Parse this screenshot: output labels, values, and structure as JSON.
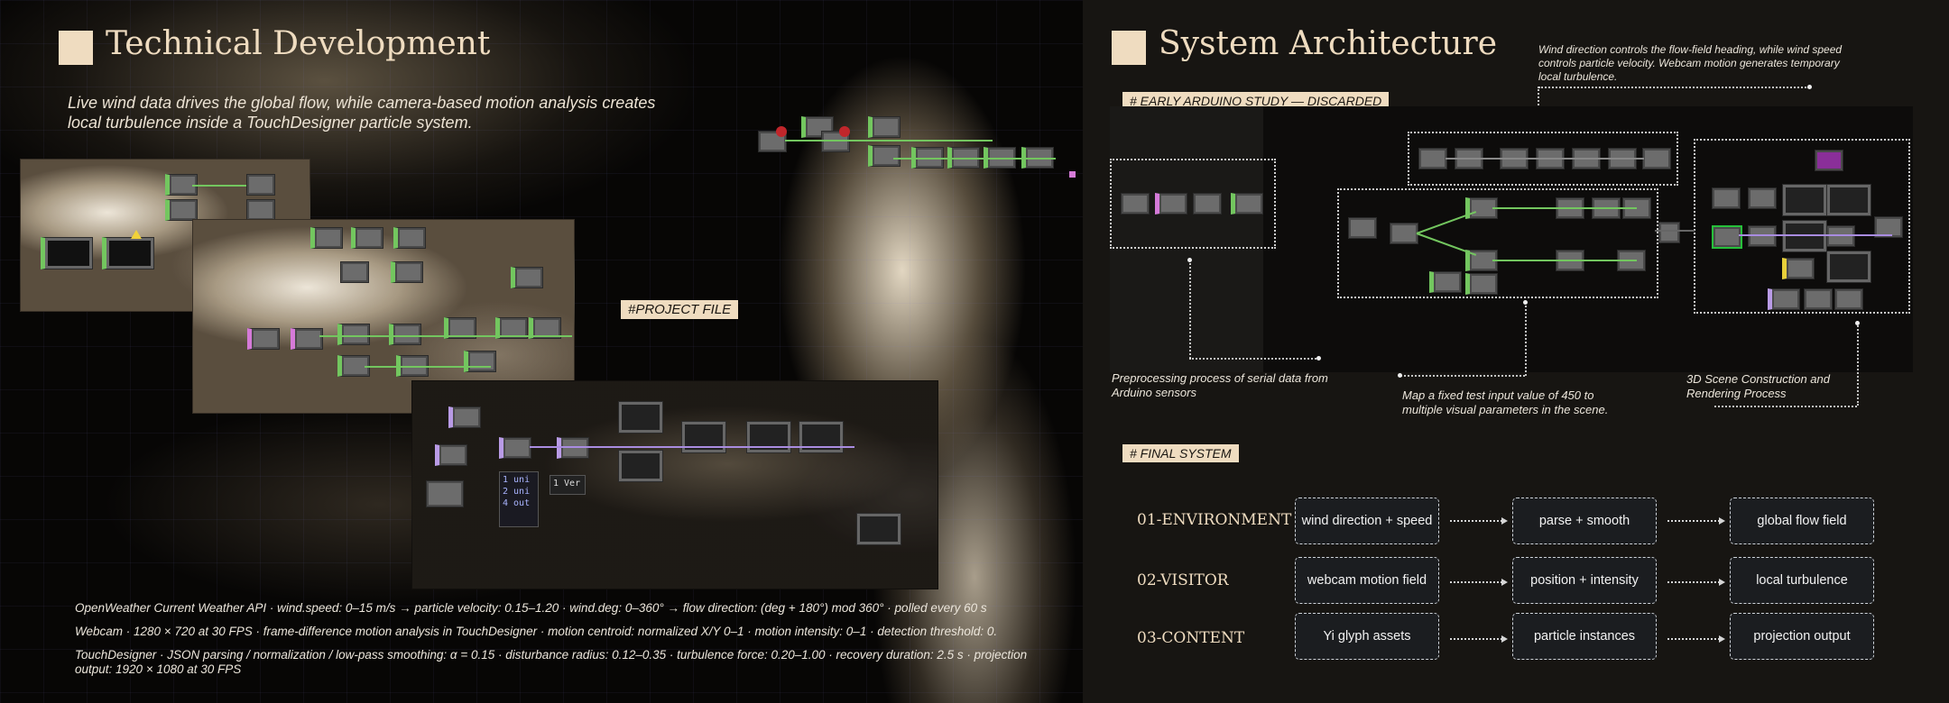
{
  "left": {
    "title": "Technical Development",
    "subtitle": "Live wind data drives the global flow, while camera-based motion analysis creates local turbulence inside a TouchDesigner particle system.",
    "project_tag": "#PROJECT FILE",
    "footnotes": [
      "OpenWeather Current Weather API · wind.speed: 0–15 m/s → particle velocity: 0.15–1.20 · wind.deg: 0–360° → flow direction: (deg + 180°) mod 360° · polled every 60 s",
      "Webcam · 1280 × 720 at 30 FPS · frame-difference motion analysis in TouchDesigner · motion centroid: normalized X/Y 0–1 · motion intensity: 0–1 · detection threshold: 0.",
      "TouchDesigner · JSON parsing / normalization / low-pass smoothing: α = 0.15 · disturbance radius: 0.12–0.35 · turbulence force: 0.20–1.00 · recovery duration: 2.5 s · projection output: 1920 × 1080 at 30 FPS"
    ],
    "code_lines": [
      "1 uni",
      "2 uni",
      "",
      "4 out"
    ],
    "code_label": "1 Ver"
  },
  "right": {
    "title": "System Architecture",
    "top_note": "Wind direction controls the flow-field heading, while wind speed controls particle velocity. Webcam motion generates temporary local turbulence.",
    "early_tag": "# EARLY ARDUINO STUDY — DISCARDED",
    "captions": {
      "serial": "Preprocessing process of serial data from Arduino sensors",
      "map": "Map a fixed test input value of 450 to multiple visual parameters in the scene.",
      "scene": "3D Scene Construction and Rendering Process"
    },
    "final_tag": "# FINAL SYSTEM",
    "rows": [
      {
        "label": "01-ENVIRONMENT",
        "steps": [
          "wind direction + speed",
          "parse + smooth",
          "global flow field"
        ]
      },
      {
        "label": "02-VISITOR",
        "steps": [
          "webcam motion field",
          "position + intensity",
          "local turbulence"
        ]
      },
      {
        "label": "03-CONTENT",
        "steps": [
          "Yi glyph assets",
          "particle instances",
          "projection output"
        ]
      }
    ]
  },
  "colors": {
    "accent": "#efdcc0",
    "node_green": "#73c65f",
    "node_purple": "#b99be6",
    "panel_dark": "#171512"
  }
}
